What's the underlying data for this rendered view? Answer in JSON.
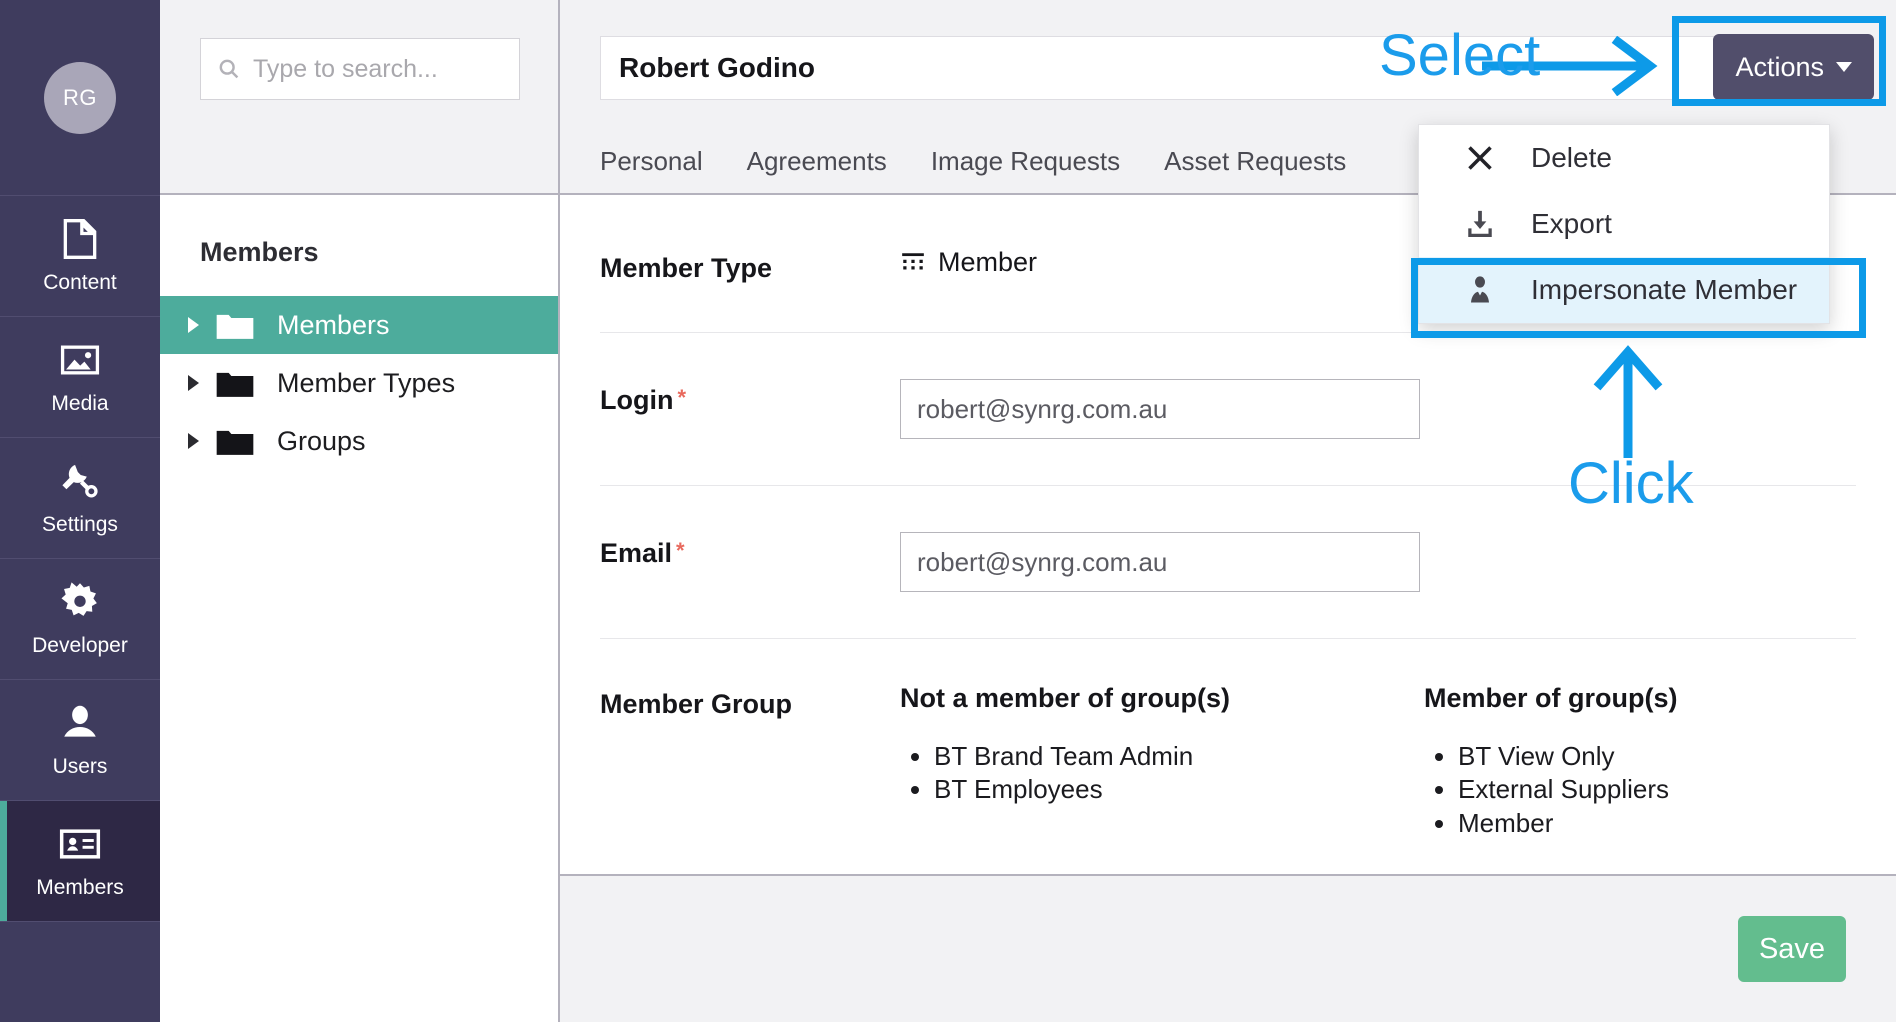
{
  "rail": {
    "avatar_initials": "RG",
    "items": [
      {
        "label": "Content",
        "icon": "document-icon",
        "active": false
      },
      {
        "label": "Media",
        "icon": "image-icon",
        "active": false
      },
      {
        "label": "Settings",
        "icon": "wrench-icon",
        "active": false
      },
      {
        "label": "Developer",
        "icon": "gear-icon",
        "active": false
      },
      {
        "label": "Users",
        "icon": "user-icon",
        "active": false
      },
      {
        "label": "Members",
        "icon": "id-card-icon",
        "active": true
      }
    ]
  },
  "tree": {
    "search_placeholder": "Type to search...",
    "section_title": "Members",
    "items": [
      {
        "label": "Members",
        "selected": true
      },
      {
        "label": "Member Types",
        "selected": false
      },
      {
        "label": "Groups",
        "selected": false
      }
    ]
  },
  "header": {
    "member_name": "Robert Godino",
    "tabs": [
      {
        "label": "Personal"
      },
      {
        "label": "Agreements"
      },
      {
        "label": "Image Requests"
      },
      {
        "label": "Asset Requests"
      }
    ],
    "actions_label": "Actions"
  },
  "dropdown": {
    "items": [
      {
        "label": "Delete",
        "icon": "close-x-icon",
        "highlighted": false
      },
      {
        "label": "Export",
        "icon": "download-icon",
        "highlighted": false
      },
      {
        "label": "Impersonate Member",
        "icon": "person-icon",
        "highlighted": true
      }
    ]
  },
  "form": {
    "member_type_label": "Member Type",
    "member_type_value": "Member",
    "login_label": "Login",
    "login_value": "robert@synrg.com.au",
    "email_label": "Email",
    "email_value": "robert@synrg.com.au",
    "required_marker": "*",
    "member_group_label": "Member Group",
    "not_member_heading": "Not a member of group(s)",
    "not_member_groups": [
      "BT Brand Team Admin",
      "BT Employees"
    ],
    "member_heading": "Member of group(s)",
    "member_groups": [
      "BT View Only",
      "External Suppliers",
      "Member"
    ]
  },
  "footer": {
    "save_label": "Save"
  },
  "annotations": {
    "select_label": "Select",
    "click_label": "Click",
    "accent_color": "#0d9ae8"
  },
  "colors": {
    "rail_bg": "#3f3c5e",
    "rail_active_bg": "#2e2845",
    "teal": "#4dac9c",
    "save_green": "#63bd8e",
    "actions_btn": "#514e6b",
    "required_red": "#e8695d"
  }
}
